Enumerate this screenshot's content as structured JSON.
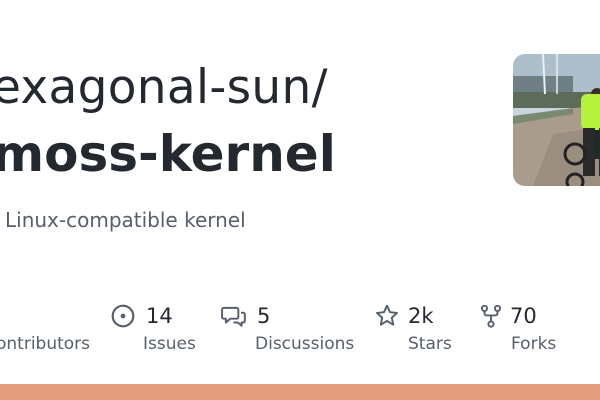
{
  "repo": {
    "owner": "exagonal-sun/",
    "name": "moss-kernel",
    "description": "Linux-compatible kernel"
  },
  "stats": {
    "contributors": {
      "label": "ontributors"
    },
    "issues": {
      "value": "14",
      "label": "Issues",
      "icon": "issue-opened-icon"
    },
    "discussions": {
      "value": "5",
      "label": "Discussions",
      "icon": "comment-discussion-icon"
    },
    "stars": {
      "value": "2k",
      "label": "Stars",
      "icon": "star-icon"
    },
    "forks": {
      "value": "70",
      "label": "Forks",
      "icon": "repo-forked-icon"
    }
  },
  "colors": {
    "text": "#24292f",
    "muted": "#57606a",
    "language_bar": "#e19d7e"
  }
}
